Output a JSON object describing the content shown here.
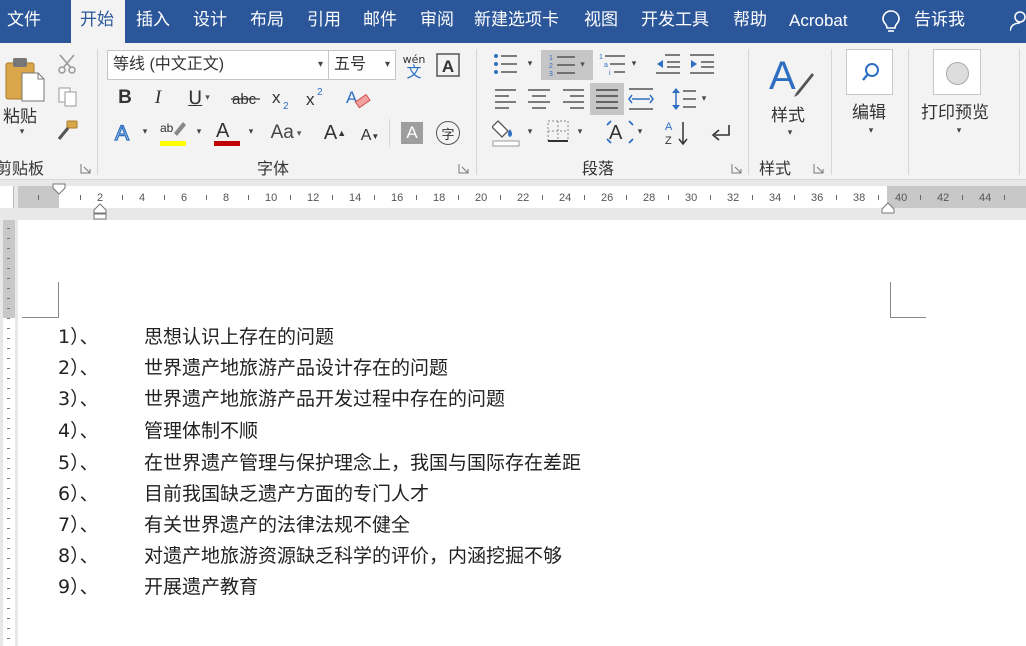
{
  "tabs": [
    "文件",
    "开始",
    "插入",
    "设计",
    "布局",
    "引用",
    "邮件",
    "审阅",
    "新建选项卡",
    "视图",
    "开发工具",
    "帮助",
    "Acrobat",
    "告诉我"
  ],
  "active_tab": "开始",
  "ribbon": {
    "clipboard": {
      "paste_label": "粘贴",
      "group_label": "剪贴板"
    },
    "font": {
      "font_name": "等线 (中文正文)",
      "font_size": "五号",
      "pinyin_top": "wén",
      "pinyin_bottom": "文",
      "group_label": "字体",
      "grow_label": "A",
      "shrink_label": "A",
      "case_label": "Aa",
      "shading_label": "A",
      "circle_label": "字"
    },
    "paragraph": {
      "group_label": "段落"
    },
    "styles": {
      "button_label": "样式",
      "group_label": "样式"
    },
    "editing": {
      "button_label": "编辑"
    },
    "print_preview": {
      "button_label": "打印预览"
    }
  },
  "ruler": {
    "labels": [
      "2",
      "4",
      "6",
      "8",
      "10",
      "12",
      "14",
      "16",
      "18",
      "20",
      "22",
      "24",
      "26",
      "28",
      "30",
      "32",
      "34",
      "36",
      "38",
      "40",
      "42",
      "44"
    ]
  },
  "document": {
    "items": [
      {
        "num": "1）、",
        "text": "思想认识上存在的问题"
      },
      {
        "num": "2）、",
        "text": "世界遗产地旅游产品设计存在的问题"
      },
      {
        "num": "3）、",
        "text": "世界遗产地旅游产品开发过程中存在的问题"
      },
      {
        "num": "4）、",
        "text": "管理体制不顺"
      },
      {
        "num": "5）、",
        "text": "在世界遗产管理与保护理念上，我国与国际存在差距"
      },
      {
        "num": "6）、",
        "text": "目前我国缺乏遗产方面的专门人才"
      },
      {
        "num": "7）、",
        "text": "有关世界遗产的法律法规不健全"
      },
      {
        "num": "8）、",
        "text": "对遗产地旅游资源缺乏科学的评价，内涵挖掘不够"
      },
      {
        "num": "9）、",
        "text": "开展遗产教育"
      }
    ]
  },
  "colors": {
    "tabbar": "#2b579a",
    "ribbon": "#f3f3f3",
    "accent_blue": "#2e6fc2",
    "font_color_red": "#c00000",
    "highlight_yellow": "#ffff00"
  }
}
